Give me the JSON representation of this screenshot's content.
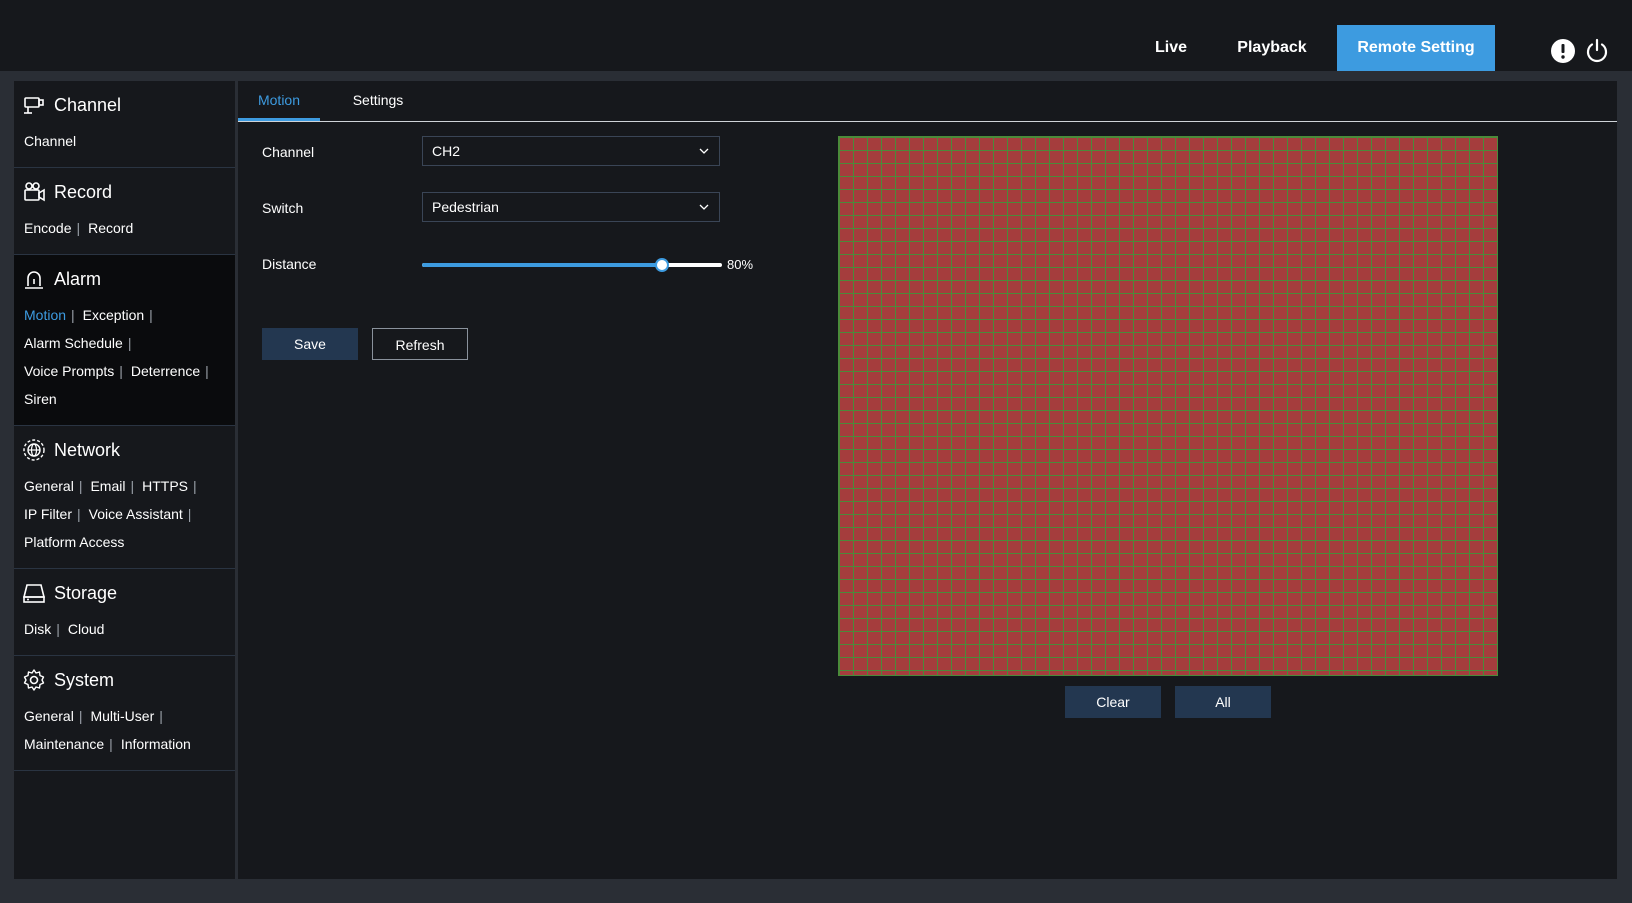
{
  "header": {
    "nav": {
      "live": "Live",
      "playback": "Playback",
      "remote_setting": "Remote Setting"
    },
    "icons": [
      "info-icon",
      "power-icon"
    ],
    "accent_color": "#3d9be0"
  },
  "sidebar": {
    "channel": {
      "title": "Channel",
      "links": [
        "Channel"
      ]
    },
    "record": {
      "title": "Record",
      "links": [
        "Encode",
        "Record"
      ]
    },
    "alarm": {
      "title": "Alarm",
      "links": [
        "Motion",
        "Exception",
        "Alarm Schedule",
        "Voice Prompts",
        "Deterrence",
        "Siren"
      ],
      "selected": "Motion"
    },
    "network": {
      "title": "Network",
      "links": [
        "General",
        "Email",
        "HTTPS",
        "IP Filter",
        "Voice Assistant",
        "Platform Access"
      ]
    },
    "storage": {
      "title": "Storage",
      "links": [
        "Disk",
        "Cloud"
      ]
    },
    "system": {
      "title": "System",
      "links": [
        "General",
        "Multi-User",
        "Maintenance",
        "Information"
      ]
    },
    "separator": "|"
  },
  "main": {
    "tabs": [
      "Motion",
      "Settings"
    ],
    "active_tab": "Motion",
    "form": {
      "channel_label": "Channel",
      "channel_value": "CH2",
      "switch_label": "Switch",
      "switch_value": "Pedestrian",
      "distance_label": "Distance",
      "distance_value": "80%",
      "distance_percent": 80
    },
    "buttons": {
      "save": "Save",
      "refresh": "Refresh",
      "clear": "Clear",
      "all": "All"
    },
    "motion_grid": {
      "fill_color": "#a53d3d",
      "line_color": "#4b8a3a"
    }
  }
}
